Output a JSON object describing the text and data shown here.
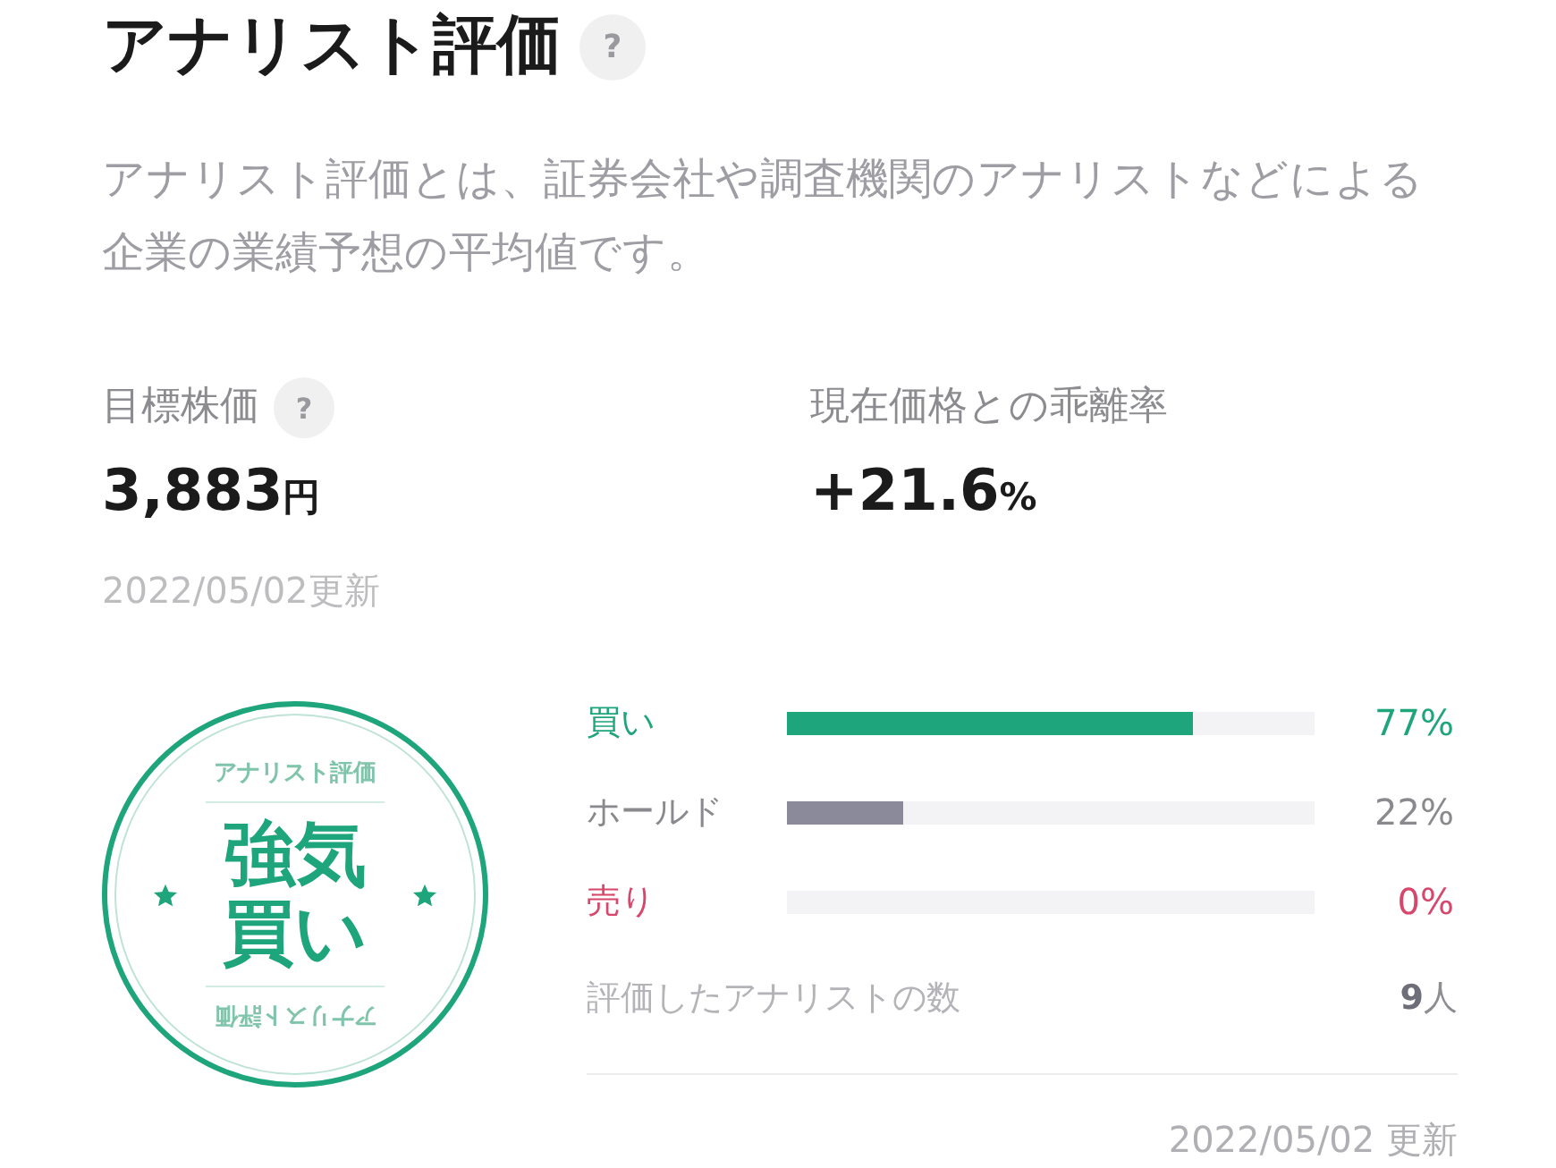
{
  "header": {
    "title": "アナリスト評価",
    "help": "?"
  },
  "description": "アナリスト評価とは、証券会社や調査機関のアナリストなどによる企業の業績予想の平均値です。",
  "target_price": {
    "label": "目標株価",
    "help": "?",
    "value": "3,883",
    "unit": "円",
    "updated": "2022/05/02更新"
  },
  "deviation": {
    "label": "現在価格との乖離率",
    "value": "+21.6",
    "unit": "%"
  },
  "seal": {
    "top_text": "アナリスト評価",
    "rating": "強気買い",
    "bottom_text": "アナリスト評価"
  },
  "ratings": [
    {
      "kind": "buy",
      "label": "買い",
      "level": 0.77,
      "reading": "77%"
    },
    {
      "kind": "hold",
      "label": "ホールド",
      "level": 0.22,
      "reading": "22%"
    },
    {
      "kind": "sell",
      "label": "売り",
      "level": 0,
      "reading": "0%"
    }
  ],
  "analyst_count": {
    "label": "評価したアナリストの数",
    "value": "9",
    "unit": "人"
  },
  "updated": "2022/05/02 更新"
}
